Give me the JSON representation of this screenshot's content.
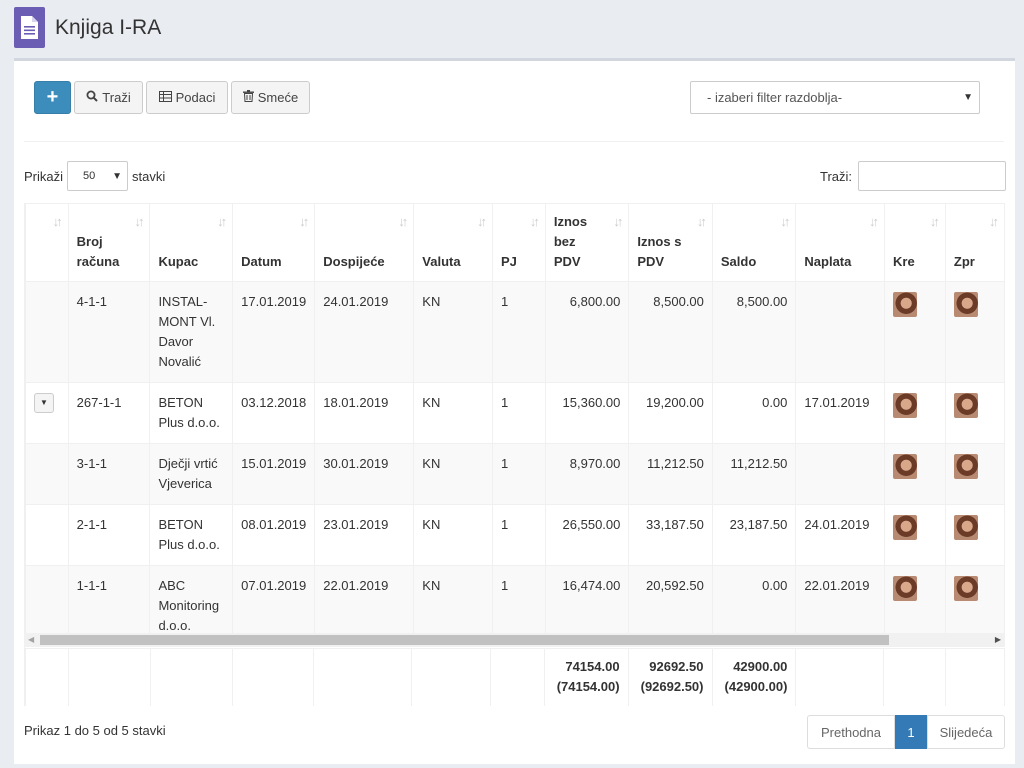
{
  "page": {
    "title": "Knjiga I-RA",
    "icon": "document-icon"
  },
  "toolbar": {
    "add_label": "+",
    "search_label": "Traži",
    "data_label": "Podaci",
    "trash_label": "Smeće",
    "filter_selected": "- izaberi filter razdoblja-"
  },
  "length_control": {
    "prefix": "Prikaži",
    "value": "50",
    "suffix": "stavki"
  },
  "search": {
    "label": "Traži:",
    "value": ""
  },
  "columns": [
    {
      "l1": "",
      "l2": "",
      "l3": ""
    },
    {
      "l1": "",
      "l2": "Broj",
      "l3": "računa"
    },
    {
      "l1": "",
      "l2": "",
      "l3": "Kupac"
    },
    {
      "l1": "",
      "l2": "",
      "l3": "Datum"
    },
    {
      "l1": "",
      "l2": "",
      "l3": "Dospijeće"
    },
    {
      "l1": "",
      "l2": "",
      "l3": "Valuta"
    },
    {
      "l1": "",
      "l2": "",
      "l3": "PJ"
    },
    {
      "l1": "Iznos",
      "l2": "bez",
      "l3": "PDV"
    },
    {
      "l1": "",
      "l2": "Iznos s",
      "l3": "PDV"
    },
    {
      "l1": "",
      "l2": "",
      "l3": "Saldo"
    },
    {
      "l1": "",
      "l2": "",
      "l3": "Naplata"
    },
    {
      "l1": "",
      "l2": "",
      "l3": "Kre"
    },
    {
      "l1": "",
      "l2": "",
      "l3": "Zpr"
    }
  ],
  "rows": [
    {
      "broj": "4-1-1",
      "kupac": "INSTAL-MONT Vl. Davor Novalić",
      "datum": "17.01.2019",
      "dospijece": "24.01.2019",
      "valuta": "KN",
      "pj": "1",
      "bez_pdv": "6,800.00",
      "s_pdv": "8,500.00",
      "saldo": "8,500.00",
      "naplata": "",
      "expand": false
    },
    {
      "broj": "267-1-1",
      "kupac": "BETON Plus d.o.o.",
      "datum": "03.12.2018",
      "dospijece": "18.01.2019",
      "valuta": "KN",
      "pj": "1",
      "bez_pdv": "15,360.00",
      "s_pdv": "19,200.00",
      "saldo": "0.00",
      "naplata": "17.01.2019",
      "expand": true
    },
    {
      "broj": "3-1-1",
      "kupac": "Dječji vrtić Vjeverica",
      "datum": "15.01.2019",
      "dospijece": "30.01.2019",
      "valuta": "KN",
      "pj": "1",
      "bez_pdv": "8,970.00",
      "s_pdv": "11,212.50",
      "saldo": "11,212.50",
      "naplata": "",
      "expand": false
    },
    {
      "broj": "2-1-1",
      "kupac": "BETON Plus d.o.o.",
      "datum": "08.01.2019",
      "dospijece": "23.01.2019",
      "valuta": "KN",
      "pj": "1",
      "bez_pdv": "26,550.00",
      "s_pdv": "33,187.50",
      "saldo": "23,187.50",
      "naplata": "24.01.2019",
      "expand": false
    },
    {
      "broj": "1-1-1",
      "kupac": "ABC Monitoring d.o.o.",
      "datum": "07.01.2019",
      "dospijece": "22.01.2019",
      "valuta": "KN",
      "pj": "1",
      "bez_pdv": "16,474.00",
      "s_pdv": "20,592.50",
      "saldo": "0.00",
      "naplata": "22.01.2019",
      "expand": false
    }
  ],
  "totals": {
    "bez_pdv": "74154.00",
    "bez_pdv_paren": "(74154.00)",
    "s_pdv": "92692.50",
    "s_pdv_paren": "(92692.50)",
    "saldo": "42900.00",
    "saldo_paren": "(42900.00)"
  },
  "footer": {
    "info": "Prikaz 1 do 5 od 5 stavki",
    "prev_label": "Prethodna",
    "current_page": "1",
    "next_label": "Slijedeća"
  },
  "colors": {
    "primary": "#3c8dbc",
    "page_icon": "#6a5db3",
    "pager_active": "#337ab7"
  }
}
